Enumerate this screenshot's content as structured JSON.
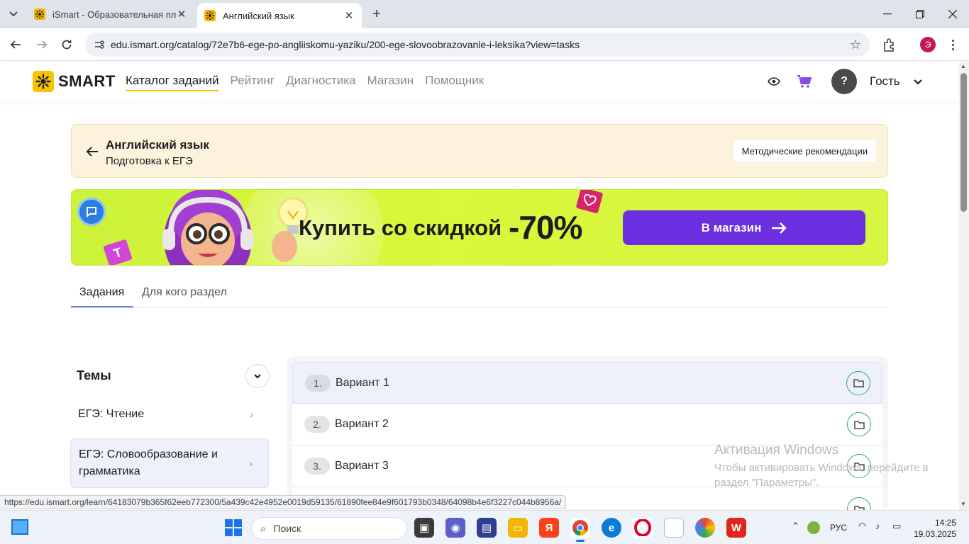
{
  "browser": {
    "tabs": [
      {
        "title": "iSmart - Образовательная пла",
        "active": false
      },
      {
        "title": "Английский язык",
        "active": true
      }
    ],
    "url": "edu.ismart.org/catalog/72e7b6-ege-po-angliiskomu-yaziku/200-ege-slovoobrazovanie-i-leksika?view=tasks",
    "profile_initial": "Э",
    "status_url": "https://edu.ismart.org/learn/64183079b365f62eeb772300/5a439c42e4952e0019d59135/61890fee84e9f601793b0348/64098b4e6f3227c044b8956a/"
  },
  "site": {
    "logo_text": "SMART",
    "nav": [
      {
        "label": "Каталог заданий",
        "active": true
      },
      {
        "label": "Рейтинг",
        "active": false
      },
      {
        "label": "Диагностика",
        "active": false
      },
      {
        "label": "Магазин",
        "active": false
      },
      {
        "label": "Помощник",
        "active": false
      }
    ],
    "help_label": "?",
    "user_label": "Гость"
  },
  "subject": {
    "title": "Английский язык",
    "subtitle": "Подготовка к ЕГЭ",
    "recommendations_label": "Методические рекомендации"
  },
  "promo": {
    "text": "Купить со скидкой",
    "discount": "-70%",
    "button_label": "В магазин",
    "badge_letter": "T"
  },
  "content_tabs": [
    {
      "label": "Задания",
      "active": true
    },
    {
      "label": "Для кого раздел",
      "active": false
    }
  ],
  "topics": {
    "title": "Темы",
    "items": [
      {
        "label": "ЕГЭ: Чтение",
        "selected": false
      },
      {
        "label": "ЕГЭ: Словообразование и грамматика",
        "selected": true
      }
    ]
  },
  "variants": [
    {
      "num": "1.",
      "label": "Вариант 1",
      "highlighted": true
    },
    {
      "num": "2.",
      "label": "Вариант 2",
      "highlighted": false
    },
    {
      "num": "3.",
      "label": "Вариант 3",
      "highlighted": false
    },
    {
      "num": "",
      "label": "",
      "highlighted": false
    }
  ],
  "activation": {
    "title": "Активация Windows",
    "text": "Чтобы активировать Windows, перейдите в раздел \"Параметры\"."
  },
  "taskbar": {
    "search_label": "Поиск",
    "apps": [
      "task-view",
      "meet",
      "save",
      "explorer",
      "yandex",
      "chrome",
      "edge",
      "opera",
      "notepad",
      "photos",
      "wps"
    ],
    "lang": "РУС",
    "time": "14:25",
    "date": "19.03.2025"
  },
  "colors": {
    "brand_yellow": "#f9c300",
    "promo_purple": "#6b2fe0",
    "promo_green": "#d4f53c",
    "folder_green": "#2aa58a",
    "selected_bg": "#eef0fa"
  }
}
